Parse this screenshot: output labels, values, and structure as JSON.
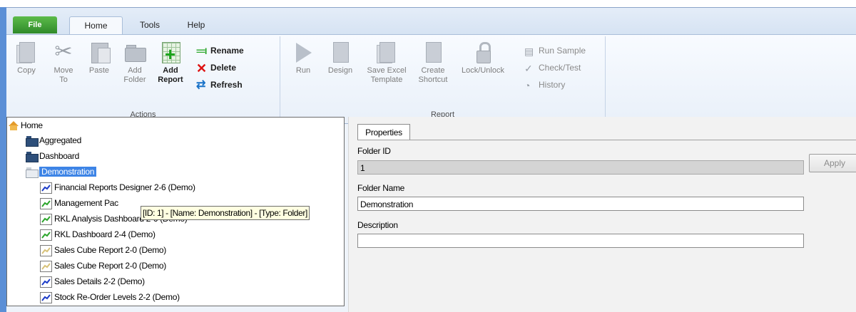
{
  "ribbon_tabs": {
    "file": "File",
    "home": "Home",
    "tools": "Tools",
    "help": "Help"
  },
  "actions_group": {
    "label": "Actions",
    "copy": "Copy",
    "move_to": "Move\nTo",
    "paste": "Paste",
    "add_folder": "Add\nFolder",
    "add_report": "Add\nReport",
    "rename": "Rename",
    "delete": "Delete",
    "refresh": "Refresh"
  },
  "report_group": {
    "label": "Report",
    "run": "Run",
    "design": "Design",
    "save_excel_template": "Save Excel\nTemplate",
    "create_shortcut": "Create\nShortcut",
    "lock_unlock": "Lock/Unlock",
    "run_sample": "Run Sample",
    "check_test": "Check/Test",
    "history": "History"
  },
  "tree": {
    "root": "Home",
    "folders": [
      "Aggregated",
      "Dashboard",
      "Demonstration"
    ],
    "selected_folder": "Demonstration",
    "reports": [
      "Financial Reports Designer 2-6 (Demo)",
      "Management Pac",
      "RKL Analysis Dashboard 2-6 (Demo)",
      "RKL Dashboard 2-4 (Demo)",
      "Sales Cube Report 2-0 (Demo)",
      "Sales Cube Report 2-0 (Demo)",
      "Sales Details 2-2 (Demo)",
      "Stock Re-Order Levels 2-2 (Demo)"
    ],
    "tooltip": "[ID: 1] - [Name: Demonstration] - [Type: Folder]"
  },
  "properties": {
    "tab": "Properties",
    "folder_id_label": "Folder ID",
    "folder_id_value": "1",
    "folder_name_label": "Folder Name",
    "folder_name_value": "Demonstration",
    "description_label": "Description",
    "description_value": "",
    "apply_button": "Apply"
  },
  "colors": {
    "file_tab": "#2f8a2a",
    "selection": "#3d84e6",
    "tooltip_bg": "#ffffe1"
  }
}
